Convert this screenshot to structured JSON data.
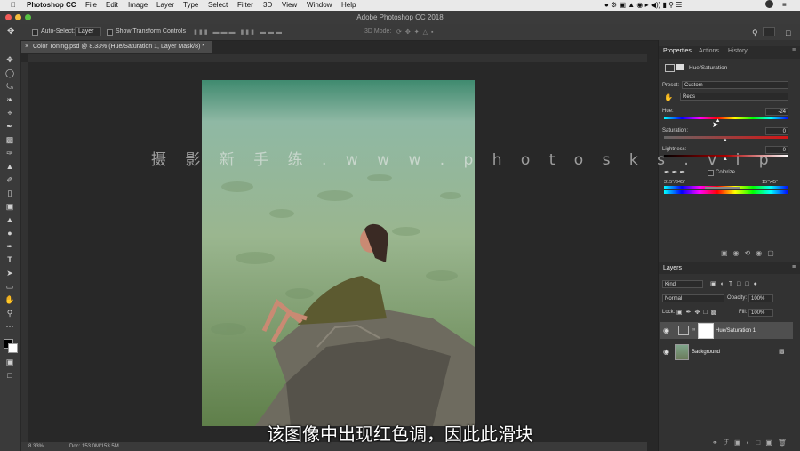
{
  "menubar": {
    "app": "Photoshop CC",
    "items": [
      "File",
      "Edit",
      "Image",
      "Layer",
      "Type",
      "Select",
      "Filter",
      "3D",
      "View",
      "Window",
      "Help"
    ]
  },
  "window_title": "Adobe Photoshop CC 2018",
  "options": {
    "auto_select_label": "Auto-Select:",
    "auto_select_value": "Layer",
    "show_transform_label": "Show Transform Controls",
    "mode_3d_label": "3D Mode:"
  },
  "document": {
    "tab_title": "Color Toning.psd @ 8.33% (Hue/Saturation 1, Layer Mask/8) *",
    "zoom": "8.33%",
    "doc_info": "Doc: 153.0M/153.5M"
  },
  "properties": {
    "tabs": [
      "Properties",
      "Actions",
      "History"
    ],
    "adjustment_title": "Hue/Saturation",
    "preset_label": "Preset:",
    "preset_value": "Custom",
    "channel_value": "Reds",
    "hue_label": "Hue:",
    "hue_value": "-24",
    "hue_fraction": 0.433,
    "saturation_label": "Saturation:",
    "saturation_value": "0",
    "lightness_label": "Lightness:",
    "lightness_value": "0",
    "colorize_label": "Colorize",
    "range_left": "315°/345°",
    "range_right": "15°\\45°"
  },
  "layers": {
    "title": "Layers",
    "filter_kind": "Kind",
    "blend_mode": "Normal",
    "opacity_label": "Opacity:",
    "opacity_value": "100%",
    "lock_label": "Lock:",
    "fill_label": "Fill:",
    "fill_value": "100%",
    "rows": [
      {
        "name": "Hue/Saturation 1"
      },
      {
        "name": "Background"
      }
    ]
  },
  "overlay": {
    "watermark": "摄 影 新 手 练 . w w w . p h o t o s k s . v i p",
    "subtitle": "该图像中出现红色调，因此此滑块"
  }
}
